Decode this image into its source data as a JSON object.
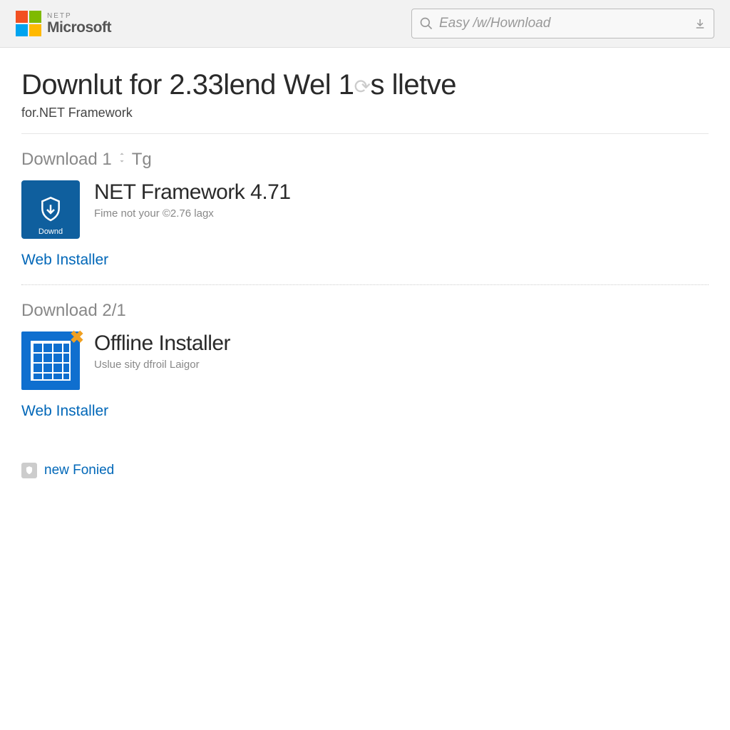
{
  "header": {
    "logo_sub": "NETP",
    "logo_main": "Microsoft",
    "search_placeholder": "Easy /w/Hownload"
  },
  "page": {
    "title_a": "Downlut for 2.33lend Wel 1",
    "title_b": "s lletve",
    "subtitle": "for.NET Framework"
  },
  "section1": {
    "label": "Download 1",
    "label_suffix": "Tg",
    "tile_label": "Downd",
    "title": "NET Framework 4.71",
    "desc": "Fime not your ©2.76 lagx",
    "link": "Web Installer"
  },
  "section2": {
    "label": "Download 2/1",
    "title": "Offline Installer",
    "desc": "Uslue sity dfroil Laigor",
    "link": "Web Installer"
  },
  "footer": {
    "link": "new Fonied"
  }
}
